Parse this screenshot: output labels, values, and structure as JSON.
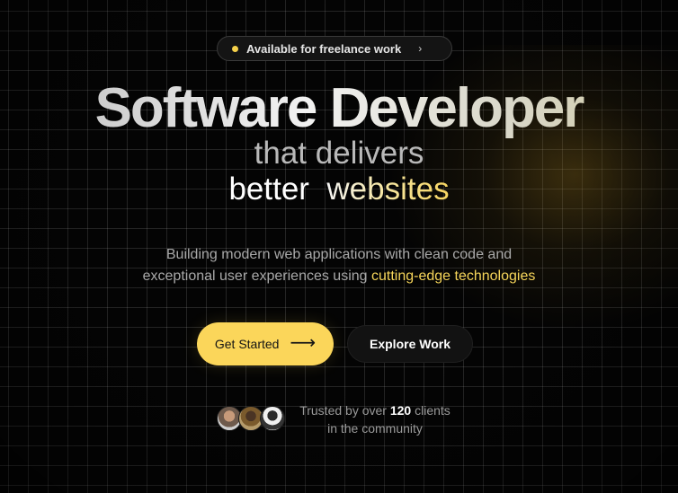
{
  "badge": {
    "label": "Available for freelance work",
    "chevron": "›",
    "dot_color": "#f5d04a"
  },
  "hero": {
    "title": "Software Developer",
    "line2": "that delivers",
    "line3_word1": "better",
    "line3_word2": "websites"
  },
  "description": {
    "line1": "Building modern web applications with clean code and",
    "line2_prefix": "exceptional user experiences using ",
    "line2_highlight": "cutting-edge technologies"
  },
  "cta": {
    "primary_label": "Get Started",
    "primary_arrow": "⟶",
    "secondary_label": "Explore Work"
  },
  "social_proof": {
    "prefix": "Trusted by over",
    "count": "120",
    "suffix": "clients",
    "line2": "in the community"
  },
  "colors": {
    "accent": "#fbd65a",
    "background": "#040404"
  }
}
